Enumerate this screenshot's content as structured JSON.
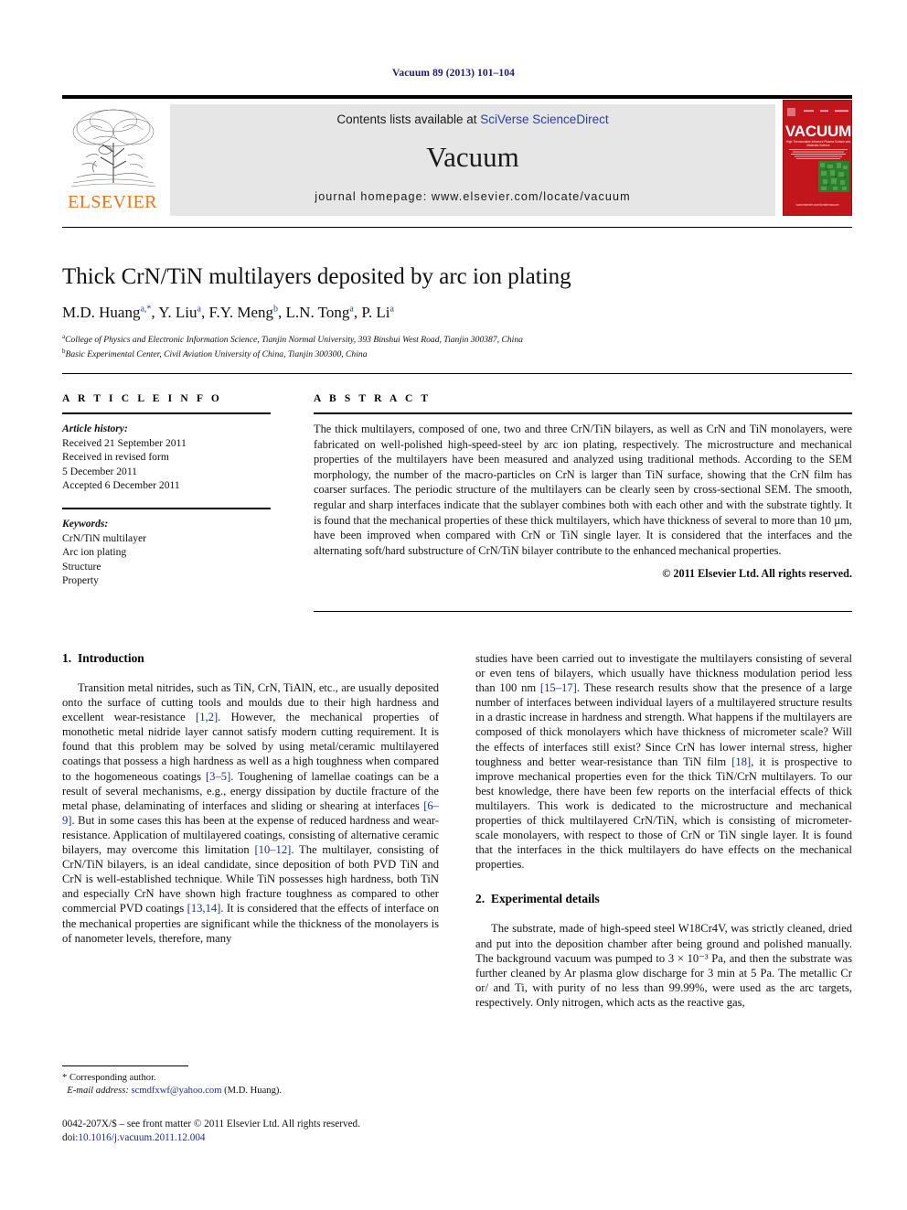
{
  "running_head": "Vacuum 89 (2013) 101–104",
  "masthead": {
    "publisher_name": "ELSEVIER",
    "contents_prefix": "Contents lists available at ",
    "contents_link": "SciVerse ScienceDirect",
    "journal_name": "Vacuum",
    "homepage": "journal homepage: www.elsevier.com/locate/vacuum",
    "link_color": "#2a3fa0",
    "panel_color": "#e6e6e6",
    "elsevier_orange": "#E87722"
  },
  "cover": {
    "title": "VACUUM",
    "subtitle": "High Thermostable Influence Plasma Surface and Materials Science",
    "url": "www.elsevier.com/locate/vacuum",
    "bg_color": "#c0161c",
    "accent_color": "#2f7d2f"
  },
  "article": {
    "title": "Thick CrN/TiN multilayers deposited by arc ion plating",
    "authors": [
      {
        "name": "M.D. Huang",
        "sup": "a,*"
      },
      {
        "name": "Y. Liu",
        "sup": "a"
      },
      {
        "name": "F.Y. Meng",
        "sup": "b"
      },
      {
        "name": "L.N. Tong",
        "sup": "a"
      },
      {
        "name": "P. Li",
        "sup": "a"
      }
    ],
    "authors_line": "M.D. Huang a,*, Y. Liu a, F.Y. Meng b, L.N. Tong a, P. Li a",
    "affiliations": [
      {
        "sup": "a",
        "text": "College of Physics and Electronic Information Science, Tianjin Normal University, 393 Binshui West Road, Tianjin 300387, China"
      },
      {
        "sup": "b",
        "text": "Basic Experimental Center, Civil Aviation University of China, Tianjin 300300, China"
      }
    ]
  },
  "article_info": {
    "heading": "A R T I C L E  I N F O",
    "history_label": "Article history:",
    "history": [
      "Received 21 September 2011",
      "Received in revised form",
      "5 December 2011",
      "Accepted 6 December 2011"
    ],
    "keywords_label": "Keywords:",
    "keywords": [
      "CrN/TiN multilayer",
      "Arc ion plating",
      "Structure",
      "Property"
    ]
  },
  "abstract": {
    "heading": "A B S T R A C T",
    "text": "The thick multilayers, composed of one, two and three CrN/TiN bilayers, as well as CrN and TiN monolayers, were fabricated on well-polished high-speed-steel by arc ion plating, respectively. The microstructure and mechanical properties of the multilayers have been measured and analyzed using traditional methods. According to the SEM morphology, the number of the macro-particles on CrN is larger than TiN surface, showing that the CrN film has coarser surfaces. The periodic structure of the multilayers can be clearly seen by cross-sectional SEM. The smooth, regular and sharp interfaces indicate that the sublayer combines both with each other and with the substrate tightly. It is found that the mechanical properties of these thick multilayers, which have thickness of several to more than 10 µm, have been improved when compared with CrN or TiN single layer. It is considered that the interfaces and the alternating soft/hard substructure of CrN/TiN bilayer contribute to the enhanced mechanical properties.",
    "copyright": "© 2011 Elsevier Ltd. All rights reserved."
  },
  "sections": {
    "intro": {
      "number": "1.",
      "title": "Introduction",
      "para1_a": "Transition metal nitrides, such as TiN, CrN, TiAlN, etc., are usually deposited onto the surface of cutting tools and moulds due to their high hardness and excellent wear-resistance ",
      "ref1": "[1,2]",
      "para1_b": ". However, the mechanical properties of monothetic metal nidride layer cannot satisfy modern cutting requirement. It is found that this problem may be solved by using metal/ceramic multilayered coatings that possess a high hardness as well as a high toughness when compared to the hogomeneous coatings ",
      "ref2": "[3–5]",
      "para1_c": ". Toughening of lamellae coatings can be a result of several mechanisms, e.g., energy dissipation by ductile fracture of the metal phase, delaminating of interfaces and sliding or shearing at interfaces ",
      "ref3": "[6–9]",
      "para1_d": ". But in some cases this has been at the expense of reduced hardness and wear-resistance. Application of multilayered coatings, consisting of alternative ceramic bilayers, may overcome this limitation ",
      "ref4": "[10–12]",
      "para1_e": ". The multilayer, consisting of CrN/TiN bilayers, is an ideal candidate, since deposition of both PVD TiN and CrN is well-established technique. While TiN possesses high hardness, both TiN and especially CrN have shown high fracture toughness as compared to other commercial PVD coatings ",
      "ref5": "[13,14]",
      "para1_f": ". It is considered that the effects of interface on the mechanical properties are significant while the thickness of the monolayers is of nanometer levels, therefore, many ",
      "para1_g": "studies have been carried out to investigate the multilayers consisting of several or even tens of bilayers, which usually have thickness modulation period less than 100 nm ",
      "ref6": "[15–17]",
      "para1_h": ". These research results show that the presence of a large number of interfaces between individual layers of a multilayered structure results in a drastic increase in hardness and strength. What happens if the multilayers are composed of thick monolayers which have thickness of micrometer scale? Will the effects of interfaces still exist? Since CrN has lower internal stress, higher toughness and better wear-resistance than TiN film ",
      "ref7": "[18]",
      "para1_i": ", it is prospective to improve mechanical properties even for the thick TiN/CrN multilayers. To our best knowledge, there have been few reports on the interfacial effects of thick multilayers. This work is dedicated to the microstructure and mechanical properties of thick multilayered CrN/TiN, which is consisting of micrometer-scale monolayers, with respect to those of CrN or TiN single layer. It is found that the interfaces in the thick multilayers do have effects on the mechanical properties."
    },
    "experimental": {
      "number": "2.",
      "title": "Experimental details",
      "para1": "The substrate, made of high-speed steel W18Cr4V, was strictly cleaned, dried and put into the deposition chamber after being ground and polished manually. The background vacuum was pumped to 3 × 10⁻³ Pa, and then the substrate was further cleaned by Ar plasma glow discharge for 3 min at 5 Pa. The metallic Cr or/ and Ti, with purity of no less than 99.99%, were used as the arc targets, respectively. Only nitrogen, which acts as the reactive gas,"
    }
  },
  "footnote": {
    "corresponding": "* Corresponding author.",
    "email_label": "E-mail address:",
    "email": "scmdfxwf@yahoo.com",
    "email_owner": "(M.D. Huang).",
    "issn_line": "0042-207X/$ – see front matter © 2011 Elsevier Ltd. All rights reserved.",
    "doi_label": "doi:",
    "doi": "10.1016/j.vacuum.2011.12.004"
  }
}
